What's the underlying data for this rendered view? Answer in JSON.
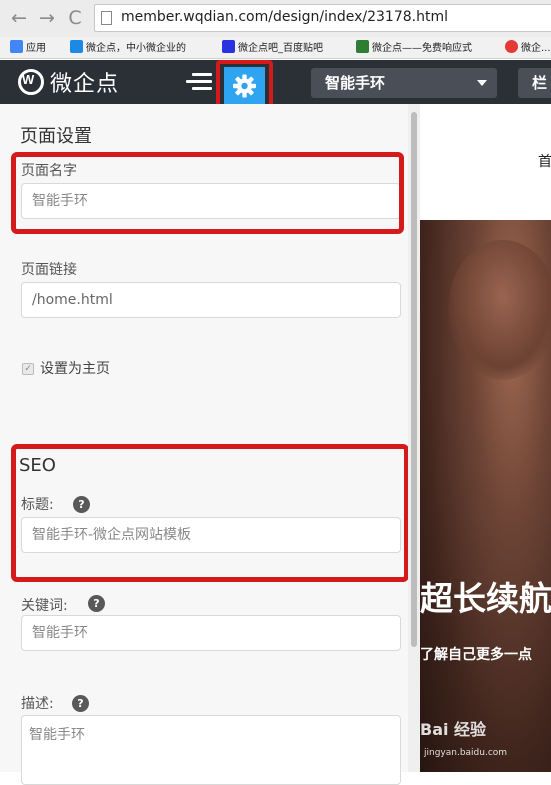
{
  "browser": {
    "url": "member.wqdian.com/design/index/23178.html",
    "back": "←",
    "forward": "→",
    "reload": "C"
  },
  "bookmarks": [
    {
      "label": "应用",
      "color": "#4285f4"
    },
    {
      "label": "微企点，中小微企业的",
      "color": "#1e88e5"
    },
    {
      "label": "微企点吧_百度贴吧",
      "color": "#2932e1"
    },
    {
      "label": "微企点——免费响应式",
      "color": "#2e7d32"
    },
    {
      "label": "微企...",
      "color": "#e53935"
    }
  ],
  "header": {
    "logo_text": "微企点",
    "page_select": "智能手环",
    "column_btn": "栏"
  },
  "panel": {
    "page_settings_title": "页面设置",
    "page_name_label": "页面名字",
    "page_name_placeholder": "智能手环",
    "page_link_label": "页面链接",
    "page_link_value": "/home.html",
    "set_home_label": "设置为主页",
    "seo_title": "SEO",
    "seo_title_label": "标题:",
    "seo_title_placeholder": "智能手环-微企点网站模板",
    "keywords_label": "关键词:",
    "keywords_placeholder": "智能手环",
    "description_label": "描述:",
    "description_placeholder": "智能手环",
    "help_glyph": "?"
  },
  "preview": {
    "nav_item": "首",
    "hero_title": "超长续航",
    "hero_sub": "了解自己更多一点",
    "watermark": "Bai 经验",
    "watermark_url": "jingyan.baidu.com"
  },
  "colors": {
    "header_bg": "#2b2f36",
    "accent": "#2fa5f2",
    "highlight": "#d41a1a"
  }
}
